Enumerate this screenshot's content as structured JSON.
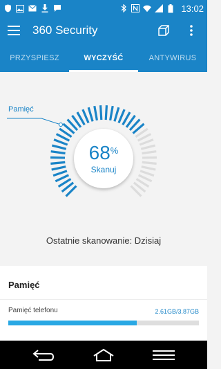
{
  "status_bar": {
    "time": "13:02",
    "left_icons": [
      "shield-icon",
      "image-icon",
      "mail-icon",
      "download-icon",
      "chat-icon"
    ],
    "right_icons": [
      "bluetooth-icon",
      "nfc-icon",
      "wifi-icon",
      "signal-icon",
      "battery-icon"
    ]
  },
  "appbar": {
    "title": "360 Security"
  },
  "tabs": [
    {
      "label": "PRZYSPIESZ",
      "active": false
    },
    {
      "label": "WYCZYŚĆ",
      "active": true
    },
    {
      "label": "ANTYWIRUS",
      "active": false
    }
  ],
  "gauge": {
    "callout_label": "Pamięć",
    "percent": "68",
    "percent_sign": "%",
    "value_fraction": 0.68,
    "scan_button": "Skanuj"
  },
  "last_scan": "Ostatnie skanowanie: Dzisiaj",
  "memory_card": {
    "title": "Pamięć",
    "items": [
      {
        "name": "Pamięć telefonu",
        "value": "2.61GB/3.87GB",
        "fraction": 0.674
      }
    ]
  },
  "colors": {
    "primary": "#1a84c7",
    "accent": "#29a8e4",
    "track": "#dcdcdc"
  }
}
